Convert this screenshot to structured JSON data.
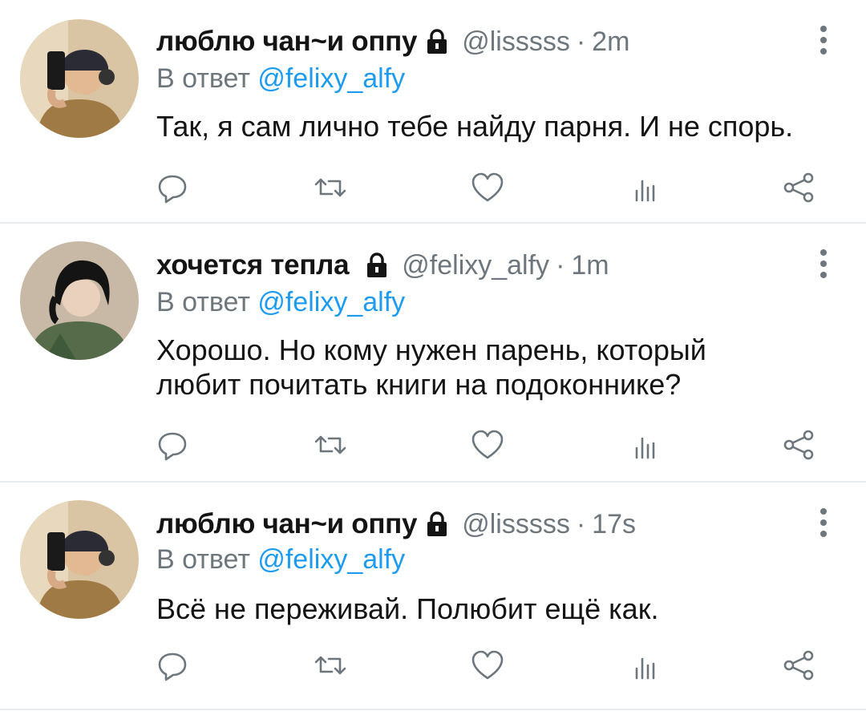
{
  "colors": {
    "accent": "#1d9bf0",
    "secondary": "#6e767d",
    "text": "#141414",
    "divider": "#e9ecef"
  },
  "tweets": [
    {
      "name": "люблю чан~и оппу",
      "handle": "@lisssss",
      "dot": "·",
      "time": "2m",
      "reply_prefix": "В ответ ",
      "reply_to": "@felixy_alfy",
      "text": "Так, я сам лично тебе найду парня. И не спорь.",
      "locked_icon": "lock-icon"
    },
    {
      "name": "хочется тепла",
      "handle": "@felixy_alfy",
      "dot": "·",
      "time": "1m",
      "reply_prefix": "В ответ ",
      "reply_to": "@felixy_alfy",
      "text": "Хорошо. Но кому нужен парень, который любит почитать книги на подоконнике?",
      "locked_icon": "lock-icon"
    },
    {
      "name": "люблю чан~и оппу",
      "handle": "@lisssss",
      "dot": "·",
      "time": "17s",
      "reply_prefix": "В ответ ",
      "reply_to": "@felixy_alfy",
      "text": "Всё не переживай. Полюбит ещё как.",
      "locked_icon": "lock-icon"
    }
  ],
  "action_icons": [
    "reply-icon",
    "retweet-icon",
    "like-icon",
    "analytics-icon",
    "share-icon"
  ]
}
